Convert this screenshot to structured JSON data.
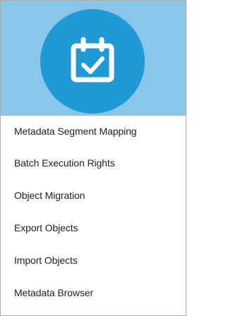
{
  "header": {
    "icon": "calendar-check-icon",
    "banner_color": "#8ac6ea",
    "circle_color": "#1f9ad6"
  },
  "menu": {
    "items": [
      {
        "label": "Metadata Segment Mapping"
      },
      {
        "label": "Batch Execution Rights"
      },
      {
        "label": "Object Migration"
      },
      {
        "label": "Export Objects"
      },
      {
        "label": "Import Objects"
      },
      {
        "label": "Metadata Browser"
      }
    ]
  }
}
